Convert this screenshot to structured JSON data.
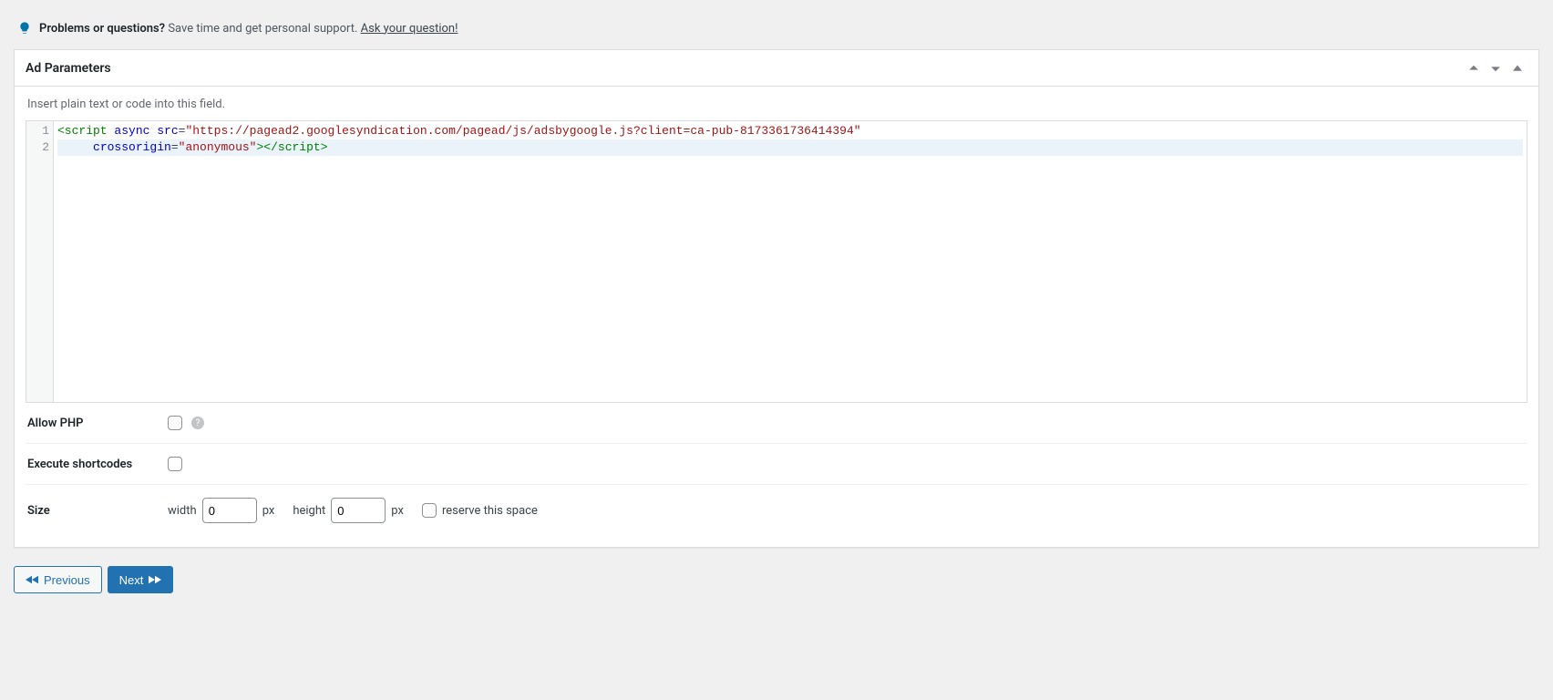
{
  "help": {
    "bold": "Problems or questions?",
    "text": "Save time and get personal support.",
    "link": "Ask your question!"
  },
  "panel": {
    "title": "Ad Parameters"
  },
  "hint": "Insert plain text or code into this field.",
  "code": {
    "lines": [
      "1",
      "2"
    ],
    "line1_raw": "<script async src=\"https://pagead2.googlesyndication.com/pagead/js/adsbygoogle.js?client=ca-pub-8173361736414394\"",
    "line2_raw": "     crossorigin=\"anonymous\"></script>"
  },
  "fields": {
    "allow_php": {
      "label": "Allow PHP",
      "checked": false
    },
    "execute_sc": {
      "label": "Execute shortcodes",
      "checked": false
    },
    "size": {
      "label": "Size",
      "width_label": "width",
      "width_value": "0",
      "height_label": "height",
      "height_value": "0",
      "unit": "px",
      "reserve_label": "reserve this space",
      "reserve_checked": false
    }
  },
  "nav": {
    "prev": "Previous",
    "next": "Next"
  }
}
